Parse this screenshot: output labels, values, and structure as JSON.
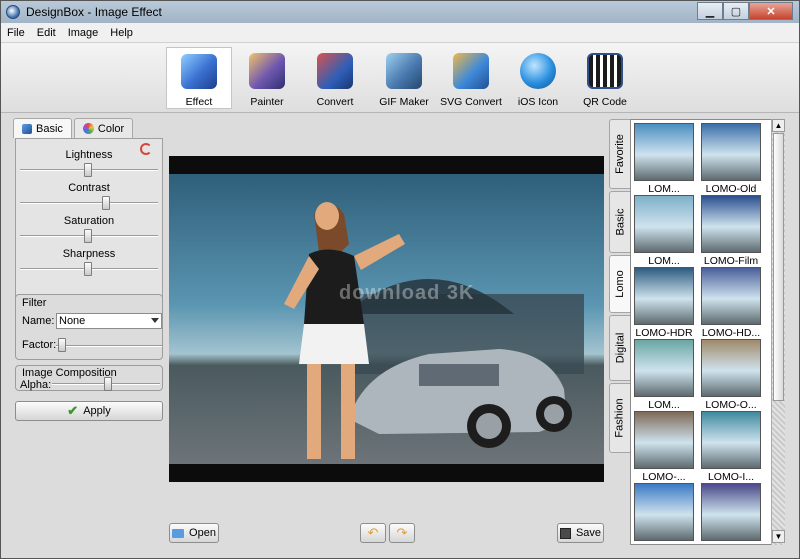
{
  "window": {
    "title": "DesignBox - Image Effect"
  },
  "menu": [
    "File",
    "Edit",
    "Image",
    "Help"
  ],
  "toolbar": [
    {
      "label": "Effect",
      "icon": "effect-icon",
      "color": "#3a6fd1"
    },
    {
      "label": "Painter",
      "icon": "painter-icon",
      "color": "#6f58b0"
    },
    {
      "label": "Convert",
      "icon": "convert-icon",
      "color": "#2f5fb8"
    },
    {
      "label": "GIF Maker",
      "icon": "gif-maker-icon",
      "color": "#4a7ab0"
    },
    {
      "label": "SVG Convert",
      "icon": "svg-convert-icon",
      "color": "#3f8ad8"
    },
    {
      "label": "iOS Icon",
      "icon": "ios-icon",
      "color": "#2a8fe0"
    },
    {
      "label": "QR Code",
      "icon": "qr-code-icon",
      "color": "#2f4f8a"
    }
  ],
  "left": {
    "tabs": [
      "Basic",
      "Color"
    ],
    "adjustments": [
      {
        "label": "Lightness",
        "value": 0.5
      },
      {
        "label": "Contrast",
        "value": 0.6
      },
      {
        "label": "Saturation",
        "value": 0.5
      },
      {
        "label": "Sharpness",
        "value": 0.5
      }
    ],
    "filter": {
      "title": "Filter",
      "name_label": "Name:",
      "name_value": "None",
      "factor_label": "Factor:",
      "factor_value": 0.0
    },
    "composition": {
      "title": "Image Composition",
      "alpha_label": "Alpha:",
      "alpha_value": 0.4
    },
    "apply_label": "Apply"
  },
  "canvas": {
    "watermark": "download 3K"
  },
  "bottom": {
    "open_label": "Open",
    "save_label": "Save"
  },
  "side_tabs": [
    "Favorite",
    "Basic",
    "Lomo",
    "Digital",
    "Fashion"
  ],
  "gallery": [
    {
      "label": "LOM...",
      "tint": "#4a8fc0"
    },
    {
      "label": "LOMO-Old",
      "tint": "#3a6fa8"
    },
    {
      "label": "LOM...",
      "tint": "#7fb0c8"
    },
    {
      "label": "LOMO-Film",
      "tint": "#2b4f8f"
    },
    {
      "label": "LOMO-HDR",
      "tint": "#2d5c80"
    },
    {
      "label": "LOMO-HD...",
      "tint": "#4a5f9a"
    },
    {
      "label": "LOM...",
      "tint": "#6aa6a4"
    },
    {
      "label": "LOMO-O...",
      "tint": "#a08a6a"
    },
    {
      "label": "LOMO-...",
      "tint": "#7e6a58"
    },
    {
      "label": "LOMO-I...",
      "tint": "#3f8aa0"
    },
    {
      "label": "",
      "tint": "#3b7bc4"
    },
    {
      "label": "",
      "tint": "#4a4a8a"
    }
  ]
}
